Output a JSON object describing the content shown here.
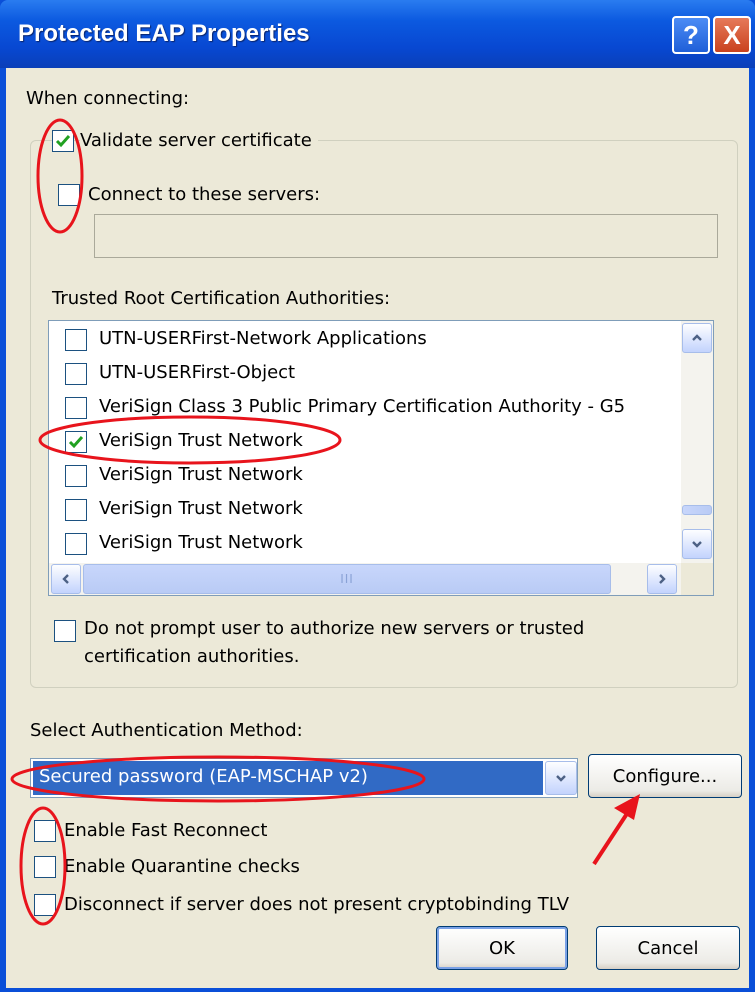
{
  "window": {
    "title": "Protected EAP Properties",
    "help_glyph": "?",
    "close_glyph": "X"
  },
  "connecting": {
    "heading": "When connecting:",
    "validate_cert": {
      "label": "Validate server certificate",
      "checked": true
    },
    "connect_servers": {
      "label": "Connect to these servers:",
      "checked": false
    },
    "servers_value": ""
  },
  "trusted": {
    "heading": "Trusted Root Certification Authorities:",
    "items": [
      {
        "label": "UTN-USERFirst-Network Applications",
        "checked": false
      },
      {
        "label": "UTN-USERFirst-Object",
        "checked": false
      },
      {
        "label": "VeriSign Class 3 Public Primary Certification Authority - G5",
        "checked": false
      },
      {
        "label": "VeriSign Trust Network",
        "checked": true
      },
      {
        "label": "VeriSign Trust Network",
        "checked": false
      },
      {
        "label": "VeriSign Trust Network",
        "checked": false
      },
      {
        "label": "VeriSign Trust Network",
        "checked": false
      }
    ],
    "scroll_mid_glyph": "III"
  },
  "no_prompt": {
    "line1": "Do not prompt user to authorize new servers or trusted",
    "line2": "certification authorities.",
    "checked": false
  },
  "auth": {
    "heading": "Select Authentication Method:",
    "selected": "Secured password (EAP-MSCHAP v2)",
    "configure_label": "Configure..."
  },
  "options": {
    "fast_reconnect": "Enable Fast Reconnect",
    "quarantine": "Enable Quarantine checks",
    "cryptobinding": "Disconnect if server does not present cryptobinding TLV"
  },
  "buttons": {
    "ok": "OK",
    "cancel": "Cancel"
  },
  "colors": {
    "title_blue": "#0a4fd8",
    "dialog_bg": "#ece9d8",
    "selection": "#316ac5",
    "annotation_red": "#e8141c",
    "check_green": "#21a121"
  }
}
